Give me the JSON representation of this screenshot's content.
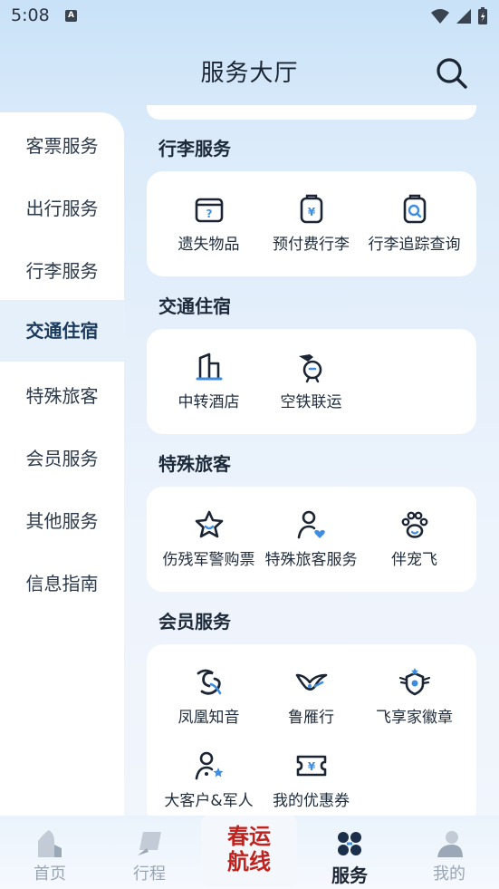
{
  "status_bar": {
    "time": "5:08",
    "a_label": "A"
  },
  "header": {
    "title": "服务大厅"
  },
  "sidebar": {
    "items": [
      {
        "label": "客票服务"
      },
      {
        "label": "出行服务"
      },
      {
        "label": "行李服务"
      },
      {
        "label": "交通住宿",
        "active": true
      },
      {
        "label": "特殊旅客"
      },
      {
        "label": "会员服务"
      },
      {
        "label": "其他服务"
      },
      {
        "label": "信息指南"
      }
    ]
  },
  "sections": {
    "baggage": {
      "title": "行李服务",
      "items": [
        {
          "label": "遗失物品",
          "icon": "lost-item-icon"
        },
        {
          "label": "预付费行李",
          "icon": "prepaid-baggage-icon"
        },
        {
          "label": "行李追踪查询",
          "icon": "baggage-tracking-icon"
        }
      ]
    },
    "transport": {
      "title": "交通住宿",
      "items": [
        {
          "label": "中转酒店",
          "icon": "hotel-icon"
        },
        {
          "label": "空铁联运",
          "icon": "air-rail-icon"
        }
      ]
    },
    "special": {
      "title": "特殊旅客",
      "items": [
        {
          "label": "伤残军警购票",
          "icon": "star-icon"
        },
        {
          "label": "特殊旅客服务",
          "icon": "user-heart-icon"
        },
        {
          "label": "伴宠飞",
          "icon": "paw-icon"
        }
      ]
    },
    "member": {
      "title": "会员服务",
      "items": [
        {
          "label": "凤凰知音",
          "icon": "phoenix-icon"
        },
        {
          "label": "鲁雁行",
          "icon": "goose-icon"
        },
        {
          "label": "飞享家徽章",
          "icon": "badge-icon"
        },
        {
          "label": "大客户&军人",
          "icon": "user-star-icon"
        },
        {
          "label": "我的优惠券",
          "icon": "coupon-icon"
        }
      ]
    }
  },
  "bottom_nav": {
    "items": [
      {
        "label": "首页"
      },
      {
        "label": "行程"
      },
      {
        "label": "服务",
        "active": true
      },
      {
        "label": "我的"
      }
    ],
    "promo": {
      "line1": "春运",
      "line2": "航线"
    }
  },
  "colors": {
    "accent": "#1b3a5c",
    "icon_blue": "#3e8de0",
    "promo_red": "#c0231e"
  }
}
